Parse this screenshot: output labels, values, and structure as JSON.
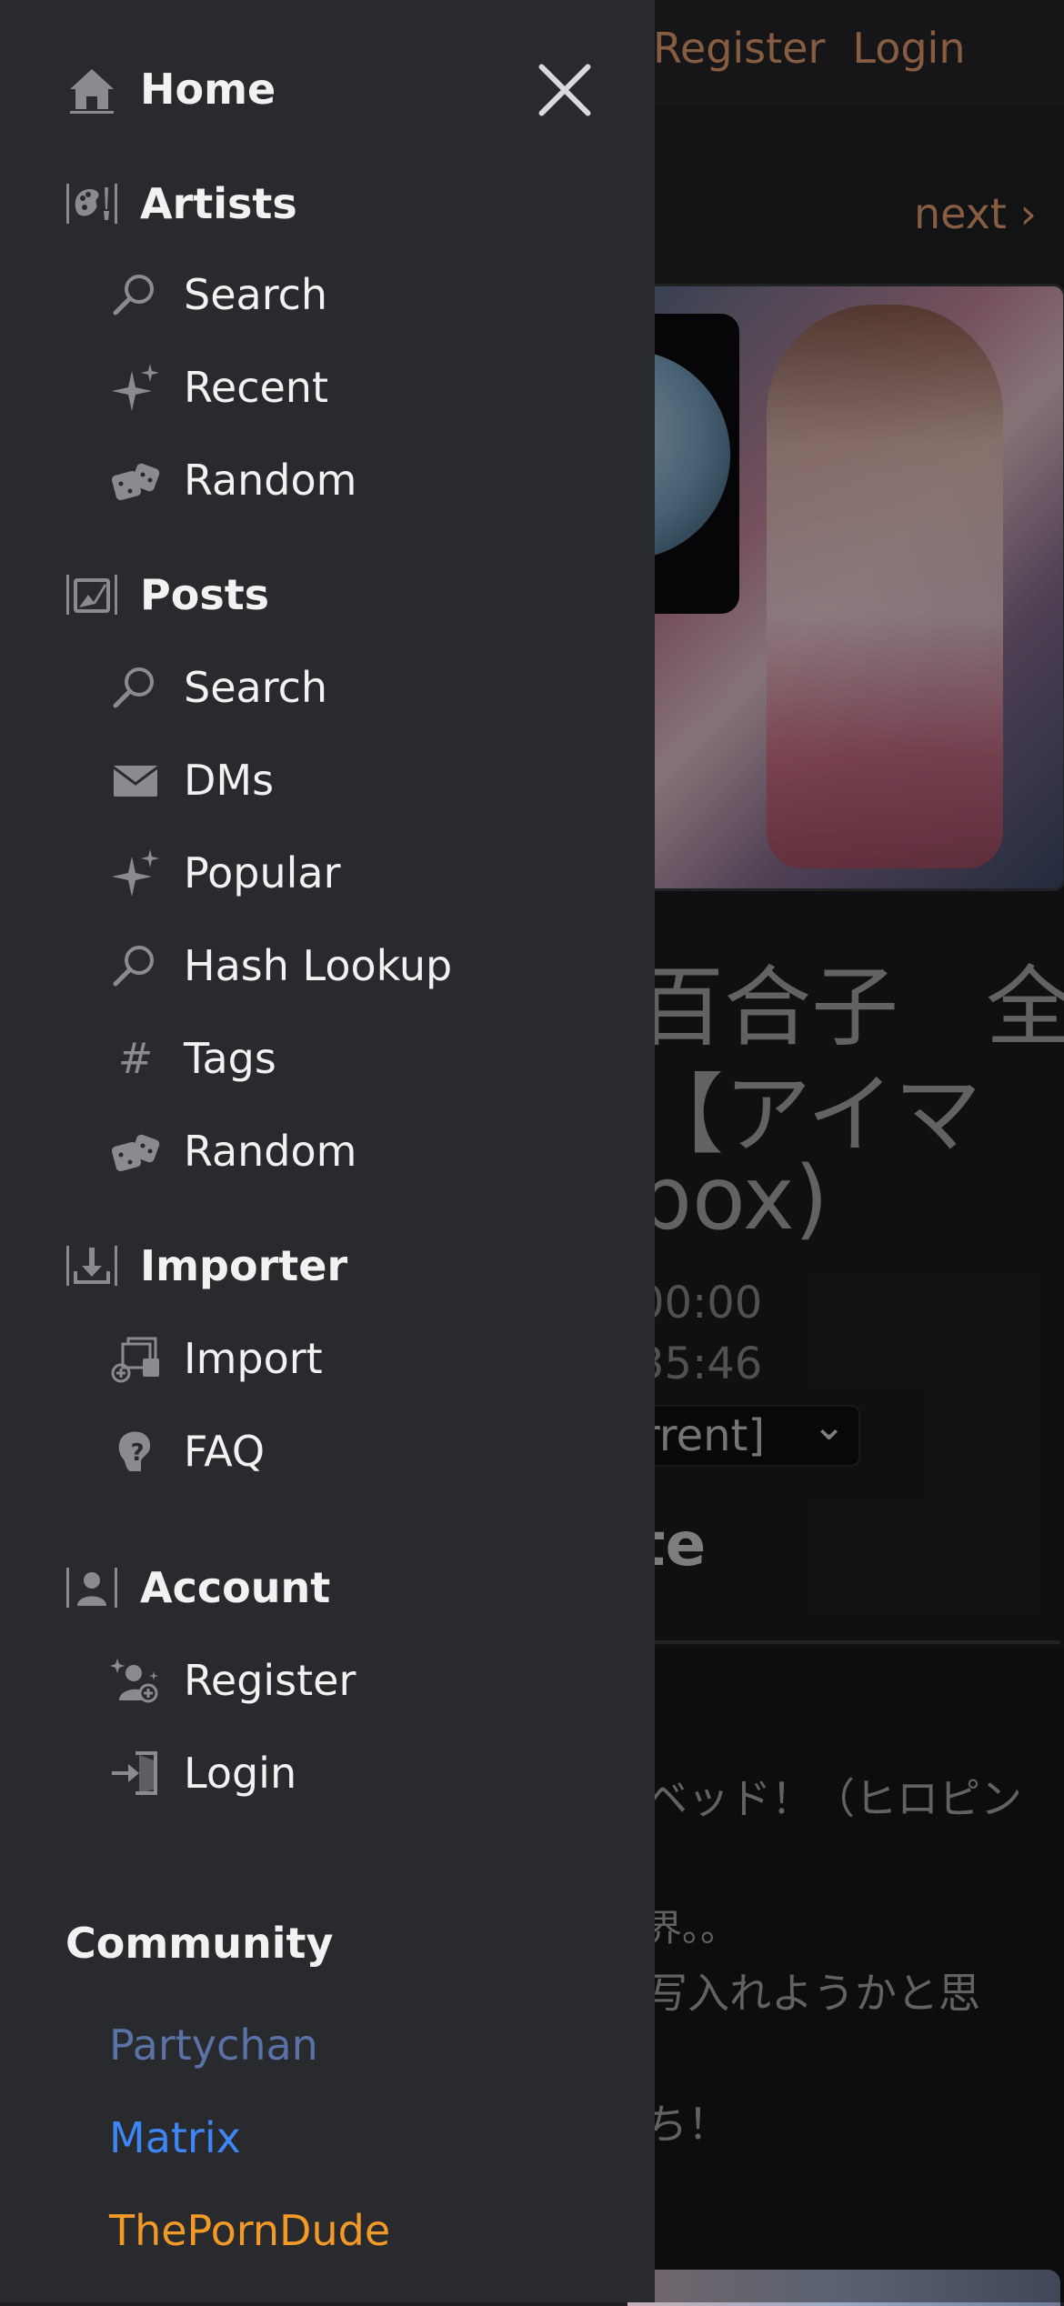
{
  "background": {
    "nav": {
      "register": "Register",
      "login": "Login"
    },
    "pager": {
      "next": "next ›"
    },
    "title_lines": [
      "百合子　全",
      "【アイマ",
      "box)"
    ],
    "dates": [
      "00:00",
      "35:46"
    ],
    "revision_select": "rrent]",
    "section_heading": "te",
    "content_lines": [
      "ベッド！（ヒロピン",
      "界。。",
      "写入れようかと思",
      "ち！"
    ]
  },
  "drawer": {
    "home": {
      "label": "Home",
      "icon": "home-icon"
    },
    "artists": {
      "label": "Artists",
      "icon": "artists-icon",
      "items": [
        {
          "label": "Search",
          "icon": "search-icon"
        },
        {
          "label": "Recent",
          "icon": "sparkle-icon"
        },
        {
          "label": "Random",
          "icon": "dice-icon"
        }
      ]
    },
    "posts": {
      "label": "Posts",
      "icon": "posts-icon",
      "items": [
        {
          "label": "Search",
          "icon": "search-icon"
        },
        {
          "label": "DMs",
          "icon": "envelope-icon"
        },
        {
          "label": "Popular",
          "icon": "sparkle-icon"
        },
        {
          "label": "Hash Lookup",
          "icon": "search-icon"
        },
        {
          "label": "Tags",
          "icon": "hash-icon"
        },
        {
          "label": "Random",
          "icon": "dice-icon"
        }
      ]
    },
    "importer": {
      "label": "Importer",
      "icon": "importer-icon",
      "items": [
        {
          "label": "Import",
          "icon": "import-icon"
        },
        {
          "label": "FAQ",
          "icon": "faq-icon"
        }
      ]
    },
    "account": {
      "label": "Account",
      "icon": "account-icon",
      "items": [
        {
          "label": "Register",
          "icon": "register-icon"
        },
        {
          "label": "Login",
          "icon": "login-icon"
        }
      ]
    },
    "community": {
      "label": "Community",
      "links": [
        {
          "label": "Partychan",
          "color": "#5a72a6"
        },
        {
          "label": "Matrix",
          "color": "#3f86f5"
        },
        {
          "label": "ThePornDude",
          "color": "#f29a28"
        }
      ]
    }
  },
  "colors": {
    "drawer_bg": "#282a2e",
    "icon": "#8a8b8f",
    "accent": "#e8a072"
  }
}
